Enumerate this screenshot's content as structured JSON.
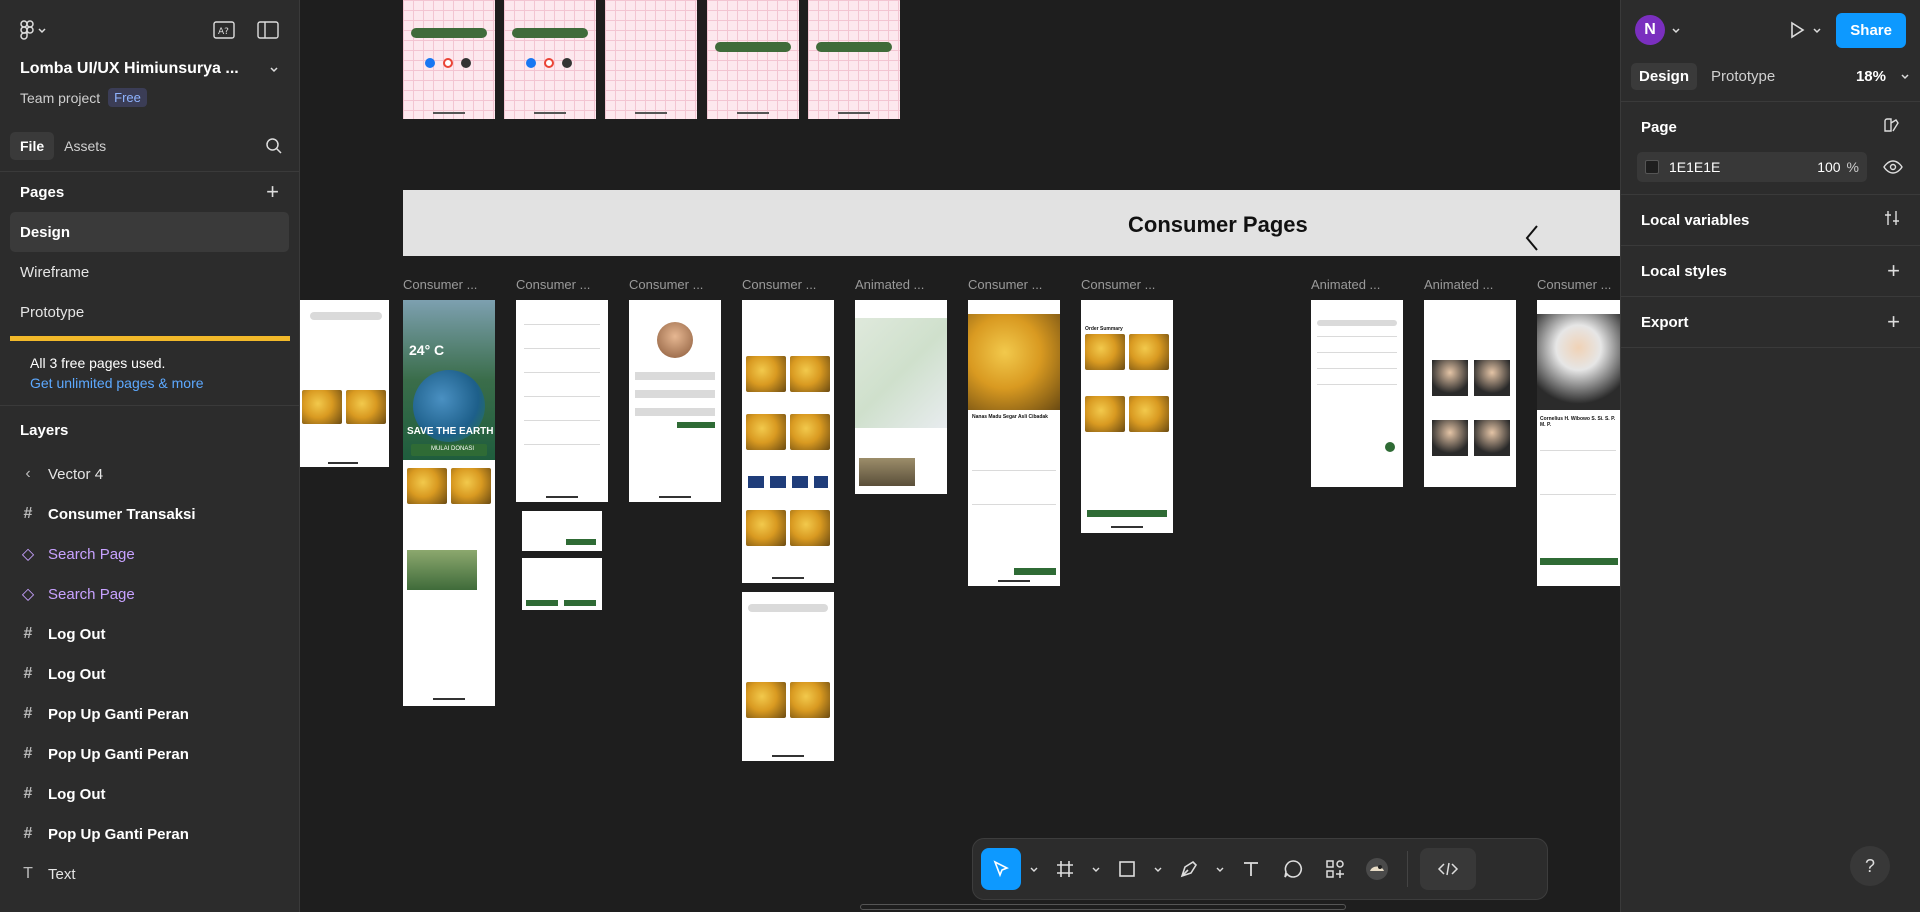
{
  "project": {
    "name": "Lomba UI/UX Himiunsurya ...",
    "team": "Team project",
    "plan": "Free"
  },
  "left_tabs": {
    "file": "File",
    "assets": "Assets"
  },
  "pages": {
    "heading": "Pages",
    "items": [
      "Design",
      "Wireframe",
      "Prototype"
    ]
  },
  "notice": {
    "text": "All 3 free pages used.",
    "link": "Get unlimited pages & more"
  },
  "layers": {
    "heading": "Layers",
    "items": [
      {
        "label": "Vector 4",
        "icon": "vector-icon"
      },
      {
        "label": "Consumer Transaksi",
        "icon": "frame-icon"
      },
      {
        "label": "Search Page",
        "icon": "component-icon"
      },
      {
        "label": "Search Page",
        "icon": "component-icon"
      },
      {
        "label": "Log Out",
        "icon": "frame-icon"
      },
      {
        "label": "Log Out",
        "icon": "frame-icon"
      },
      {
        "label": "Pop Up Ganti Peran",
        "icon": "frame-icon"
      },
      {
        "label": "Pop Up Ganti Peran",
        "icon": "frame-icon"
      },
      {
        "label": "Log Out",
        "icon": "frame-icon"
      },
      {
        "label": "Pop Up Ganti Peran",
        "icon": "frame-icon"
      },
      {
        "label": "Text",
        "icon": "text-icon"
      }
    ]
  },
  "right": {
    "avatar": "N",
    "share": "Share",
    "tabs": {
      "design": "Design",
      "prototype": "Prototype"
    },
    "zoom": "18%",
    "page_heading": "Page",
    "page_color": "1E1E1E",
    "page_opacity": "100",
    "page_opacity_unit": "%",
    "sections": [
      "Local variables",
      "Local styles",
      "Export"
    ]
  },
  "canvas": {
    "section_title": "Consumer Pages",
    "frame_titles": [
      "Consumer ...",
      "Consumer ...",
      "Consumer ...",
      "Consumer ...",
      "Animated ...",
      "Consumer ...",
      "Consumer ...",
      "Animated ...",
      "Animated ...",
      "Consumer ..."
    ],
    "screen_texts": {
      "weather": "24° C",
      "save": "SAVE THE EARTH",
      "donate": "MULAI DONASI",
      "product": "Nanas Madu Segar Asli Cibadak",
      "summary": "Order Summary",
      "profile": "Cornelius H. Wibowo S. Si. S. P. M. P."
    }
  },
  "colors": {
    "accent": "#0d99ff",
    "free_badge": "#8fb4ff",
    "notice_bar": "#f2b92a",
    "component": "#c8a2ff",
    "brand_green": "#2f6b35"
  }
}
